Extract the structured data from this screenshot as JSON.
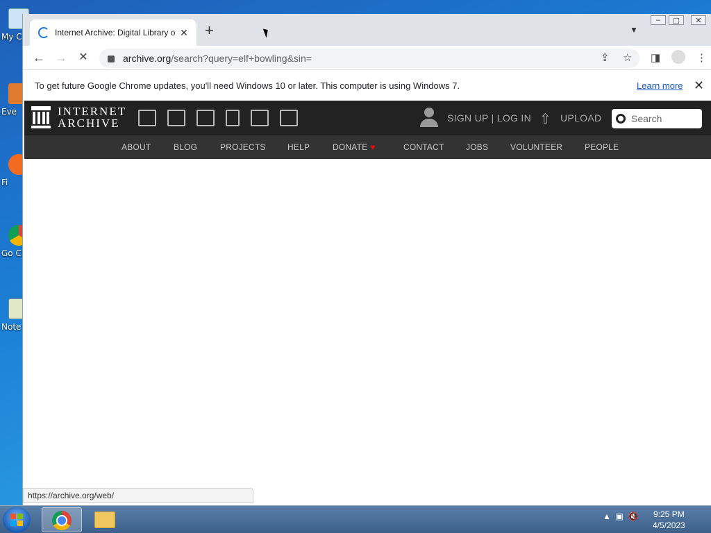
{
  "desktop": {
    "icons": [
      {
        "label": "My C",
        "icon": "computer-icon"
      },
      {
        "label": "Eve",
        "icon": "app-icon"
      },
      {
        "label": "Fi",
        "icon": "firefox-icon"
      },
      {
        "label": "Go Ch",
        "icon": "chrome-icon"
      },
      {
        "label": "Note",
        "icon": "notepad-icon"
      }
    ]
  },
  "browser": {
    "tab": {
      "title": "Internet Archive: Digital Library o",
      "close": "✕"
    },
    "new_tab": "+",
    "url_host": "archive.org",
    "url_path": "/search?query=elf+bowling&sin=",
    "infobar": {
      "message": "To get future Google Chrome updates, you'll need Windows 10 or later. This computer is using Windows 7.",
      "learn_more": "Learn more",
      "close": "✕"
    },
    "status_url": "https://archive.org/web/"
  },
  "ia": {
    "logo_line1": "INTERNET",
    "logo_line2": "ARCHIVE",
    "signup_login": "SIGN UP | LOG IN",
    "upload": "UPLOAD",
    "search_placeholder": "Search",
    "nav": [
      "ABOUT",
      "BLOG",
      "PROJECTS",
      "HELP",
      "DONATE",
      "CONTACT",
      "JOBS",
      "VOLUNTEER",
      "PEOPLE"
    ],
    "media_icons": [
      "web-icon",
      "texts-icon",
      "video-icon",
      "audio-icon",
      "software-icon",
      "images-icon"
    ]
  },
  "taskbar": {
    "time": "9:25 PM",
    "date": "4/5/2023"
  },
  "colors": {
    "ia_header": "#222222",
    "ia_nav": "#333333",
    "donate_heart": "#e30f16",
    "link_blue": "#1a57c7"
  }
}
